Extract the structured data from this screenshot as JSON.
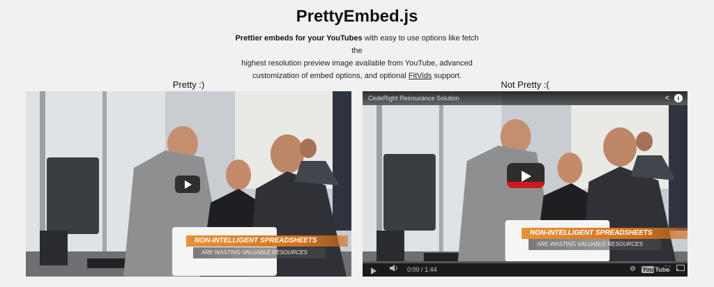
{
  "header": {
    "title": "PrettyEmbed.js",
    "intro_bold": "Prettier embeds for your YouTubes",
    "intro_line1_rest": " with easy to use options like fetch the",
    "intro_line2": "highest resolution preview image available from YouTube, advanced",
    "intro_line3_pre": "customization of embed options, and optional ",
    "intro_link": "FitVids",
    "intro_line3_post": " support."
  },
  "left": {
    "label": "Pretty :)",
    "banner1": "NON-INTELLIGENT SPREADSHEETS",
    "banner2": "ARE WASTING VALUABLE RESOURCES"
  },
  "right": {
    "label": "Not Pretty :(",
    "video_title": "CedeRight Reinsurance Solution",
    "banner1": "NON-INTELLIGENT SPREADSHEETS",
    "banner2": "ARE WASTING VALUABLE RESOURCES",
    "time": "0:00 / 1:44",
    "yt_you": "You",
    "yt_tube": "Tube",
    "info_glyph": "i",
    "share_glyph": "<"
  },
  "colors": {
    "background": "#f1f1f1",
    "banner_orange": "#d2711d",
    "youtube_red": "#cc181e"
  }
}
